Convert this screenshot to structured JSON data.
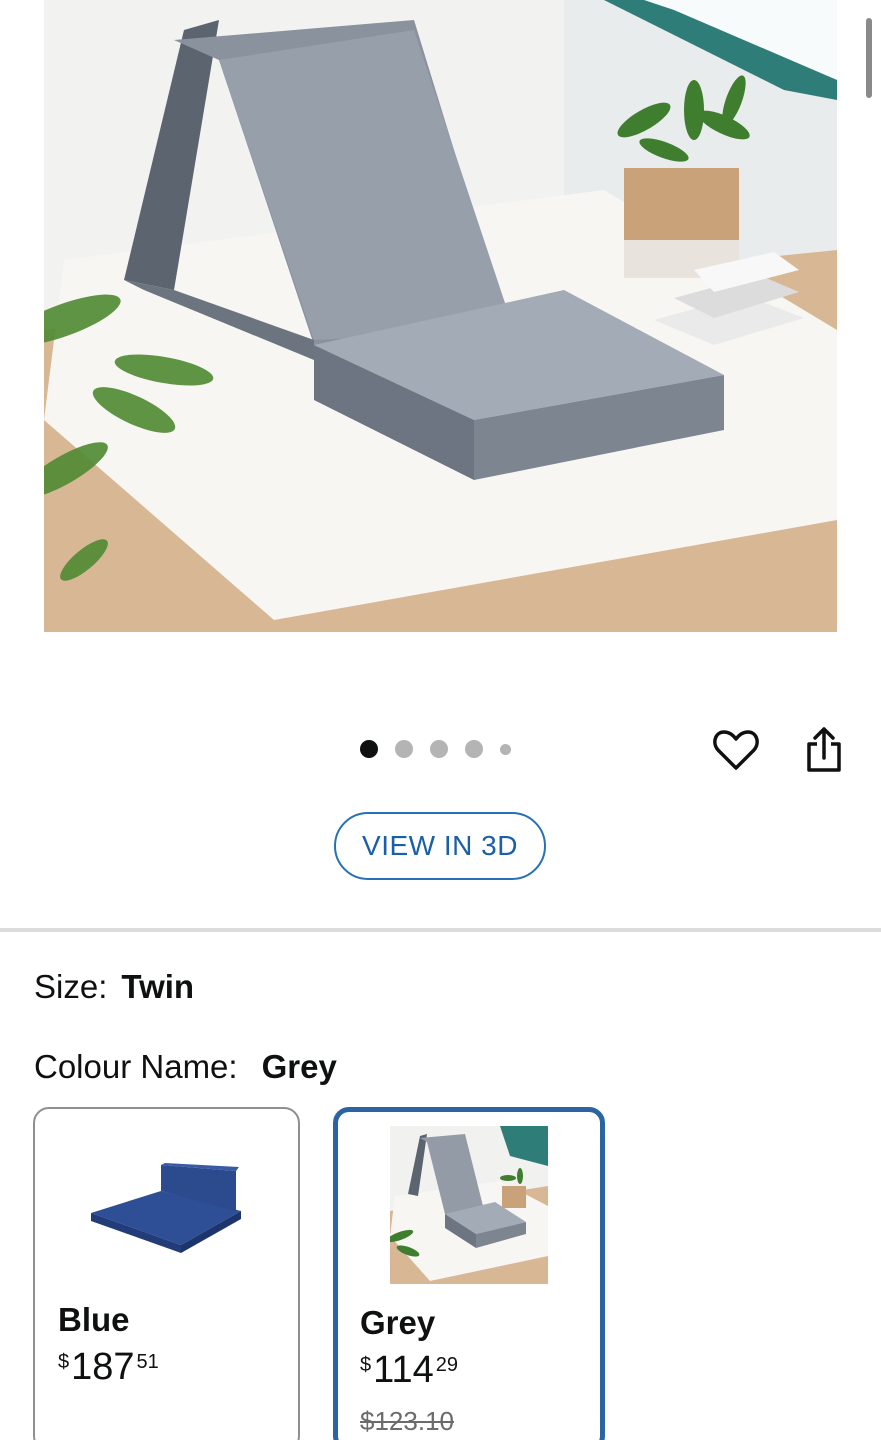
{
  "product_image": {
    "alt_icon": "tri-fold-mattress-photo"
  },
  "carousel": {
    "dot_count": 5,
    "active_index": 0
  },
  "actions": {
    "wishlist_icon": "heart-icon",
    "share_icon": "share-icon"
  },
  "view_3d": {
    "label": "VIEW IN 3D"
  },
  "variants": {
    "size_label": "Size:",
    "size_value": "Twin",
    "colour_label": "Colour Name:",
    "colour_value": "Grey",
    "options": [
      {
        "name": "Blue",
        "currency": "$",
        "price_whole": "187",
        "price_fraction": "51",
        "selected": false
      },
      {
        "name": "Grey",
        "currency": "$",
        "price_whole": "114",
        "price_fraction": "29",
        "old_price": "$123.10",
        "selected": true
      }
    ]
  },
  "colors": {
    "accent_blue": "#2a64a2",
    "link_blue": "#1a5fa8",
    "divider": "#dcdcdc"
  }
}
